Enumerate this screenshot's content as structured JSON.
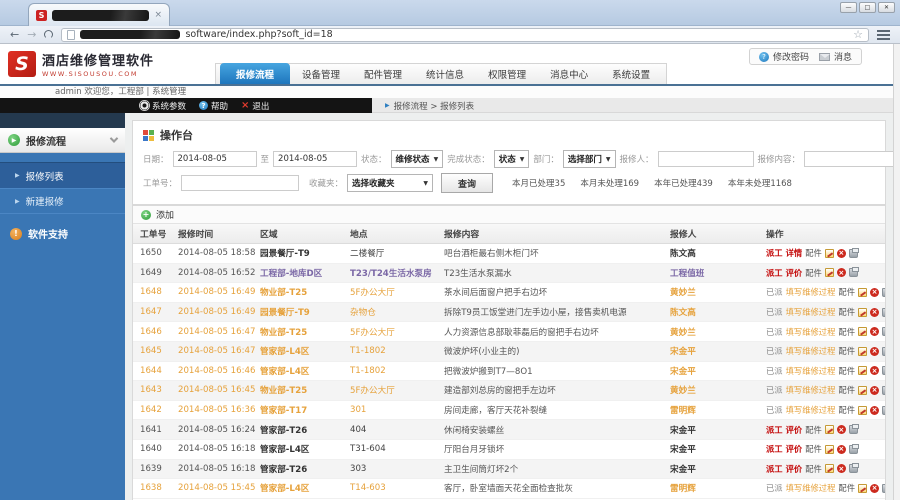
{
  "colors": {
    "accent_blue": "#1e76bd",
    "sidebar_blue": "#3a76b4",
    "orange": "#e6a23c",
    "purple": "#7b68a6",
    "link_red": "#c40a0a",
    "brand_red": "#cc2222"
  },
  "browser": {
    "url_suffix": "software/index.php?soft_id=18",
    "favicon_letter": "S",
    "tab_close": "×"
  },
  "brand": {
    "logo_letter": "S",
    "title": "酒店维修管理软件",
    "subtitle": "WWW.SISOUSOU.COM"
  },
  "account": {
    "change_password": "修改密码",
    "messages": "消息"
  },
  "nav": {
    "tabs": [
      {
        "label": "报修流程",
        "active": true
      },
      {
        "label": "设备管理",
        "active": false
      },
      {
        "label": "配件管理",
        "active": false
      },
      {
        "label": "统计信息",
        "active": false
      },
      {
        "label": "权限管理",
        "active": false
      },
      {
        "label": "消息中心",
        "active": false
      },
      {
        "label": "系统设置",
        "active": false
      }
    ]
  },
  "welcome": {
    "text": "admin 欢迎您，工程部 | 系统管理"
  },
  "toolbar": {
    "system_params": "系统参数",
    "help": "帮助",
    "logout": "退出"
  },
  "breadcrumb": {
    "text": "报修流程 > 报修列表"
  },
  "sidebar": {
    "group_label": "报修流程",
    "items": [
      {
        "label": "报修列表",
        "active": true
      },
      {
        "label": "新建报修",
        "active": false
      }
    ],
    "support_label": "软件支持"
  },
  "console": {
    "title": "操作台",
    "filters": {
      "date_label": "日期：",
      "date_from": "2014-08-05",
      "to_label": "至",
      "date_to": "2014-08-05",
      "status_label": "状态：",
      "status_value": "维修状态",
      "finish_label": "完成状态：",
      "finish_value": "状态",
      "dept_label": "部门：",
      "dept_value": "选择部门",
      "reporter_label": "报修人：",
      "content_label": "报修内容：",
      "order_label": "工单号：",
      "favorites_label": "收藏夹：",
      "favorites_value": "选择收藏夹",
      "search_button": "查询"
    },
    "stats": [
      "本月已处理35",
      "本月未处理169",
      "本年已处理439",
      "本年未处理1168"
    ]
  },
  "table": {
    "add_label": "添加",
    "columns": [
      "工单号",
      "报修时间",
      "区域",
      "地点",
      "报修内容",
      "报修人",
      "操作"
    ],
    "rows": [
      {
        "id": "1650",
        "time": "2014-08-05 18:58",
        "area": "园景餐厅-T9",
        "place": "二楼餐厅",
        "content": "吧台酒柜最右侧木柜门坏",
        "reporter": "陈文高",
        "ops": [
          "派工",
          "详情",
          "配件"
        ],
        "style": "normal"
      },
      {
        "id": "1649",
        "time": "2014-08-05 16:52",
        "area": "工程部-地库D区",
        "place": "T23/T24生活水泵房",
        "content": "T23生活水泵漏水",
        "reporter": "工程值班",
        "ops": [
          "派工",
          "评价",
          "配件"
        ],
        "style": "visited"
      },
      {
        "id": "1648",
        "time": "2014-08-05 16:49",
        "area": "物业部-T25",
        "place": "5F办公大厅",
        "content": "茶水间后面窗户把手右边坏",
        "reporter": "黄妙兰",
        "ops": [
          "已派",
          "填写维修过程",
          "配件"
        ],
        "style": "orange"
      },
      {
        "id": "1647",
        "time": "2014-08-05 16:49",
        "area": "园景餐厅-T9",
        "place": "杂物仓",
        "content": "拆除T9员工饭堂进门左手边小屋，接售卖机电源",
        "reporter": "陈文高",
        "ops": [
          "已派",
          "填写维修过程",
          "配件"
        ],
        "style": "orange"
      },
      {
        "id": "1646",
        "time": "2014-08-05 16:47",
        "area": "物业部-T25",
        "place": "5F办公大厅",
        "content": "人力资源信息部耿菲磊后的窗把手右边坏",
        "reporter": "黄妙兰",
        "ops": [
          "已派",
          "填写维修过程",
          "配件"
        ],
        "style": "orange"
      },
      {
        "id": "1645",
        "time": "2014-08-05 16:47",
        "area": "管家部-L4区",
        "place": "T1-1802",
        "content": "微波炉坏(小业主的)",
        "reporter": "宋金平",
        "ops": [
          "已派",
          "填写维修过程",
          "配件"
        ],
        "style": "orange"
      },
      {
        "id": "1644",
        "time": "2014-08-05 16:46",
        "area": "管家部-L4区",
        "place": "T1-1802",
        "content": "把微波炉搬到T7—8O1",
        "reporter": "宋金平",
        "ops": [
          "已派",
          "填写维修过程",
          "配件"
        ],
        "style": "orange"
      },
      {
        "id": "1643",
        "time": "2014-08-05 16:45",
        "area": "物业部-T25",
        "place": "5F办公大厅",
        "content": "建造部刘总房的窗把手左边坏",
        "reporter": "黄妙兰",
        "ops": [
          "已派",
          "填写维修过程",
          "配件"
        ],
        "style": "orange"
      },
      {
        "id": "1642",
        "time": "2014-08-05 16:36",
        "area": "管家部-T17",
        "place": "301",
        "content": "房间走廊，客厅天花补裂缝",
        "reporter": "雷明辉",
        "ops": [
          "已派",
          "填写维修过程",
          "配件"
        ],
        "style": "orange"
      },
      {
        "id": "1641",
        "time": "2014-08-05 16:24",
        "area": "管家部-T26",
        "place": "404",
        "content": "休闲椅安装螺丝",
        "reporter": "宋金平",
        "ops": [
          "派工",
          "评价",
          "配件"
        ],
        "style": "normal"
      },
      {
        "id": "1640",
        "time": "2014-08-05 16:18",
        "area": "管家部-L4区",
        "place": "T31-604",
        "content": "厅阳台月牙锁坏",
        "reporter": "宋金平",
        "ops": [
          "派工",
          "评价",
          "配件"
        ],
        "style": "normal"
      },
      {
        "id": "1639",
        "time": "2014-08-05 16:18",
        "area": "管家部-T26",
        "place": "303",
        "content": "主卫生间筒灯坏2个",
        "reporter": "宋金平",
        "ops": [
          "派工",
          "评价",
          "配件"
        ],
        "style": "normal"
      },
      {
        "id": "1638",
        "time": "2014-08-05 15:45",
        "area": "管家部-L4区",
        "place": "T14-603",
        "content": "客厅，卧室墙面天花全面检查批灰",
        "reporter": "雷明辉",
        "ops": [
          "已派",
          "填写维修过程",
          "配件"
        ],
        "style": "orange"
      }
    ]
  }
}
